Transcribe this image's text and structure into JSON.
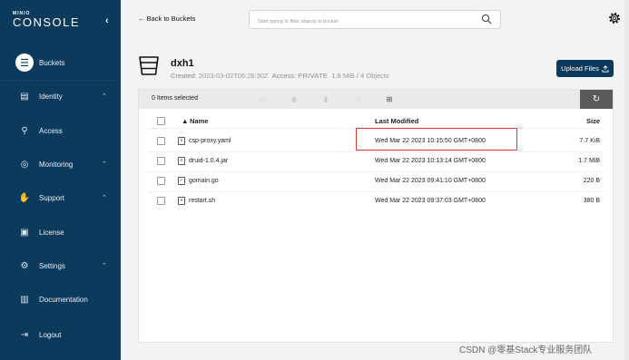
{
  "sidebar": {
    "logo_top": "MINIO",
    "logo_main": "CONSOLE",
    "collapse_glyph": "‹",
    "items": [
      {
        "label": "Buckets",
        "icon": "bucket-icon",
        "glyph": "☰",
        "expandable": false,
        "active": true
      },
      {
        "label": "Identity",
        "icon": "identity-icon",
        "glyph": "▤",
        "expandable": true
      },
      {
        "label": "Access",
        "icon": "access-icon",
        "glyph": "⚲",
        "expandable": false
      },
      {
        "label": "Monitoring",
        "icon": "monitoring-icon",
        "glyph": "◎",
        "expandable": true
      },
      {
        "label": "Support",
        "icon": "support-icon",
        "glyph": "✋",
        "expandable": true
      },
      {
        "label": "License",
        "icon": "license-icon",
        "glyph": "▣",
        "expandable": false
      },
      {
        "label": "Settings",
        "icon": "settings-icon",
        "glyph": "⚙",
        "expandable": true
      },
      {
        "label": "Documentation",
        "icon": "documentation-icon",
        "glyph": "▥",
        "expandable": false
      },
      {
        "label": "Logout",
        "icon": "logout-icon",
        "glyph": "⇥",
        "expandable": false
      }
    ],
    "chevron_glyph": "⌃"
  },
  "topbar": {
    "back_label": "← Back to Buckets",
    "search_placeholder": "Start typing to filter objects in bucket"
  },
  "bucket": {
    "name": "dxh1",
    "created_label": "Created:",
    "created_value": "2023-03-02T06:26:30Z",
    "access_label": "Access:",
    "access_value": "PRIVATE",
    "summary": "1.8 MiB / 4 Objects",
    "upload_label": "Upload Files"
  },
  "toolbar": {
    "selected_label": "0 Items selected",
    "refresh_glyph": "↻"
  },
  "table": {
    "headers": {
      "name": "Name",
      "modified": "Last Modified",
      "size": "Size"
    },
    "sort_glyph": "▲",
    "rows": [
      {
        "name": "csp-proxy.yaml",
        "modified": "Wed Mar 22 2023 10:15:50 GMT+0800",
        "size": "7.7 KiB",
        "icon_glyph": "≡"
      },
      {
        "name": "druid-1.0.4.jar",
        "modified": "Wed Mar 22 2023 10:13:14 GMT+0800",
        "size": "1.7 MiB",
        "icon_glyph": "≡"
      },
      {
        "name": "gomain.go",
        "modified": "Wed Mar 22 2023 09:41:10 GMT+0800",
        "size": "220 B",
        "icon_glyph": "✓"
      },
      {
        "name": "restart.sh",
        "modified": "Wed Mar 22 2023 09:37:03 GMT+0800",
        "size": "380 B",
        "icon_glyph": "≡"
      }
    ]
  },
  "watermark": "CSDN @零基Stack专业服务团队",
  "colors": {
    "sidebar_bg": "#0b3a5c",
    "upload_bg": "#0b3a5c",
    "highlight": "#e8322c",
    "refresh_bg": "#5a5a5a"
  }
}
